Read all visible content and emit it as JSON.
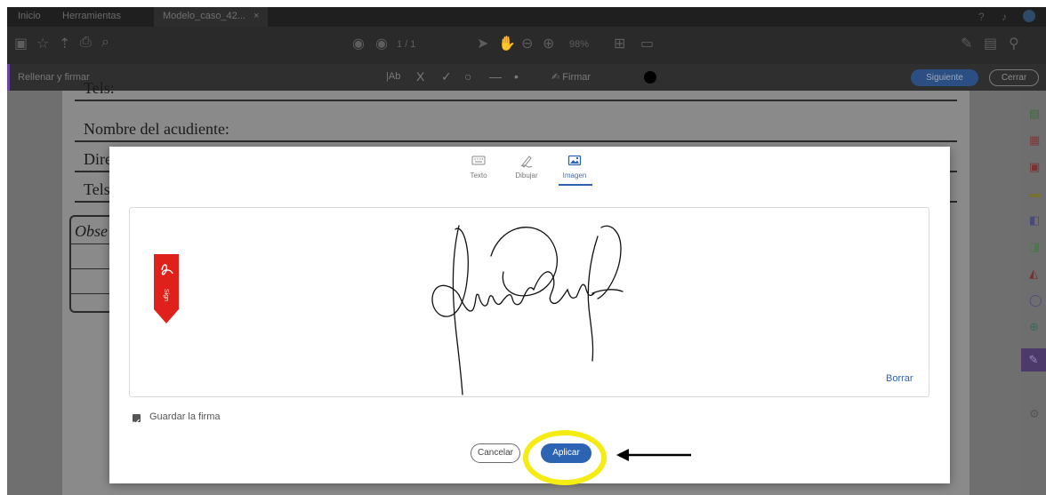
{
  "tabbar": {
    "tabs": [
      "Inicio",
      "Herramientas",
      "Modelo_caso_42..."
    ],
    "tab_close": "×"
  },
  "toolbar": {
    "page_indicator": "1 / 1",
    "zoom": "98%"
  },
  "fill_sign": {
    "title": "Rellenar y firmar",
    "tools": [
      "|Ab",
      "X",
      "✓",
      "○",
      "—",
      "•"
    ],
    "sign_label": "Firmar",
    "next_button": "Siguiente",
    "close_button": "Cerrar"
  },
  "document": {
    "visible_rows": [
      "Tels:",
      "Nombre del acudiente:",
      "Direc",
      "Tels:"
    ],
    "observations": "Obse"
  },
  "modal": {
    "tabs": [
      {
        "label": "Texto",
        "icon": "keyboard-icon"
      },
      {
        "label": "Dibujar",
        "icon": "pen-draw-icon"
      },
      {
        "label": "Imagen",
        "icon": "image-icon"
      }
    ],
    "active_tab": "Imagen",
    "flag_text": "Sign",
    "clear_label": "Borrar",
    "save_checkbox_label": "Guardar la firma",
    "save_checked": true,
    "cancel_button": "Cancelar",
    "apply_button": "Aplicar"
  },
  "colors": {
    "accent": "#2c64b3",
    "highlight": "#f4ec12",
    "flag_red": "#e0201b"
  }
}
